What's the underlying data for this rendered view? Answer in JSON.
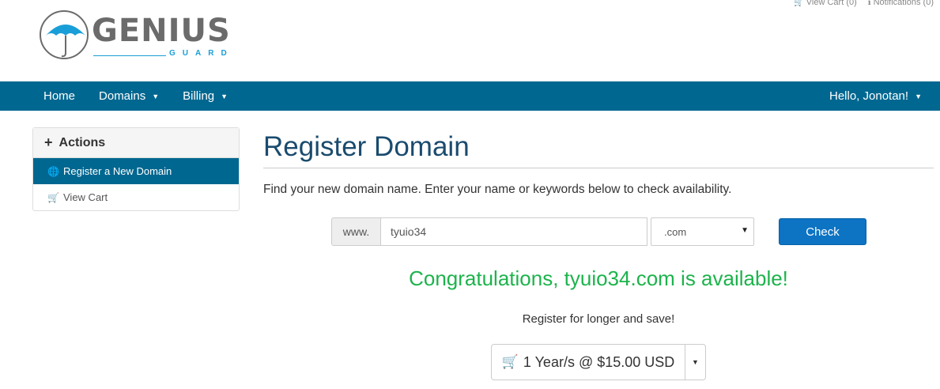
{
  "top_links": {
    "view_cart": "View Cart (0)",
    "notifications": "Notifications (0)"
  },
  "logo": {
    "word": "GENIUS",
    "sub": "GUARD",
    "colors": {
      "text": "#6b6b6b",
      "accent": "#1a9ed8"
    }
  },
  "nav": {
    "items": [
      {
        "label": "Home"
      },
      {
        "label": "Domains"
      },
      {
        "label": "Billing"
      }
    ],
    "user_label": "Hello, Jonotan!",
    "color": "#006790"
  },
  "sidebar": {
    "title": "Actions",
    "items": [
      {
        "label": "Register a New Domain",
        "icon": "globe-icon",
        "active": true
      },
      {
        "label": "View Cart",
        "icon": "cart-icon",
        "active": false
      }
    ]
  },
  "main": {
    "title": "Register Domain",
    "lead": "Find your new domain name. Enter your name or keywords below to check availability.",
    "prefix": "www.",
    "domain_value": "tyuio34",
    "tld_value": ".com",
    "check_label": "Check",
    "congrats": "Congratulations, tyuio34.com is available!",
    "save_text": "Register for longer and save!",
    "period_label": "1 Year/s @ $15.00 USD"
  }
}
